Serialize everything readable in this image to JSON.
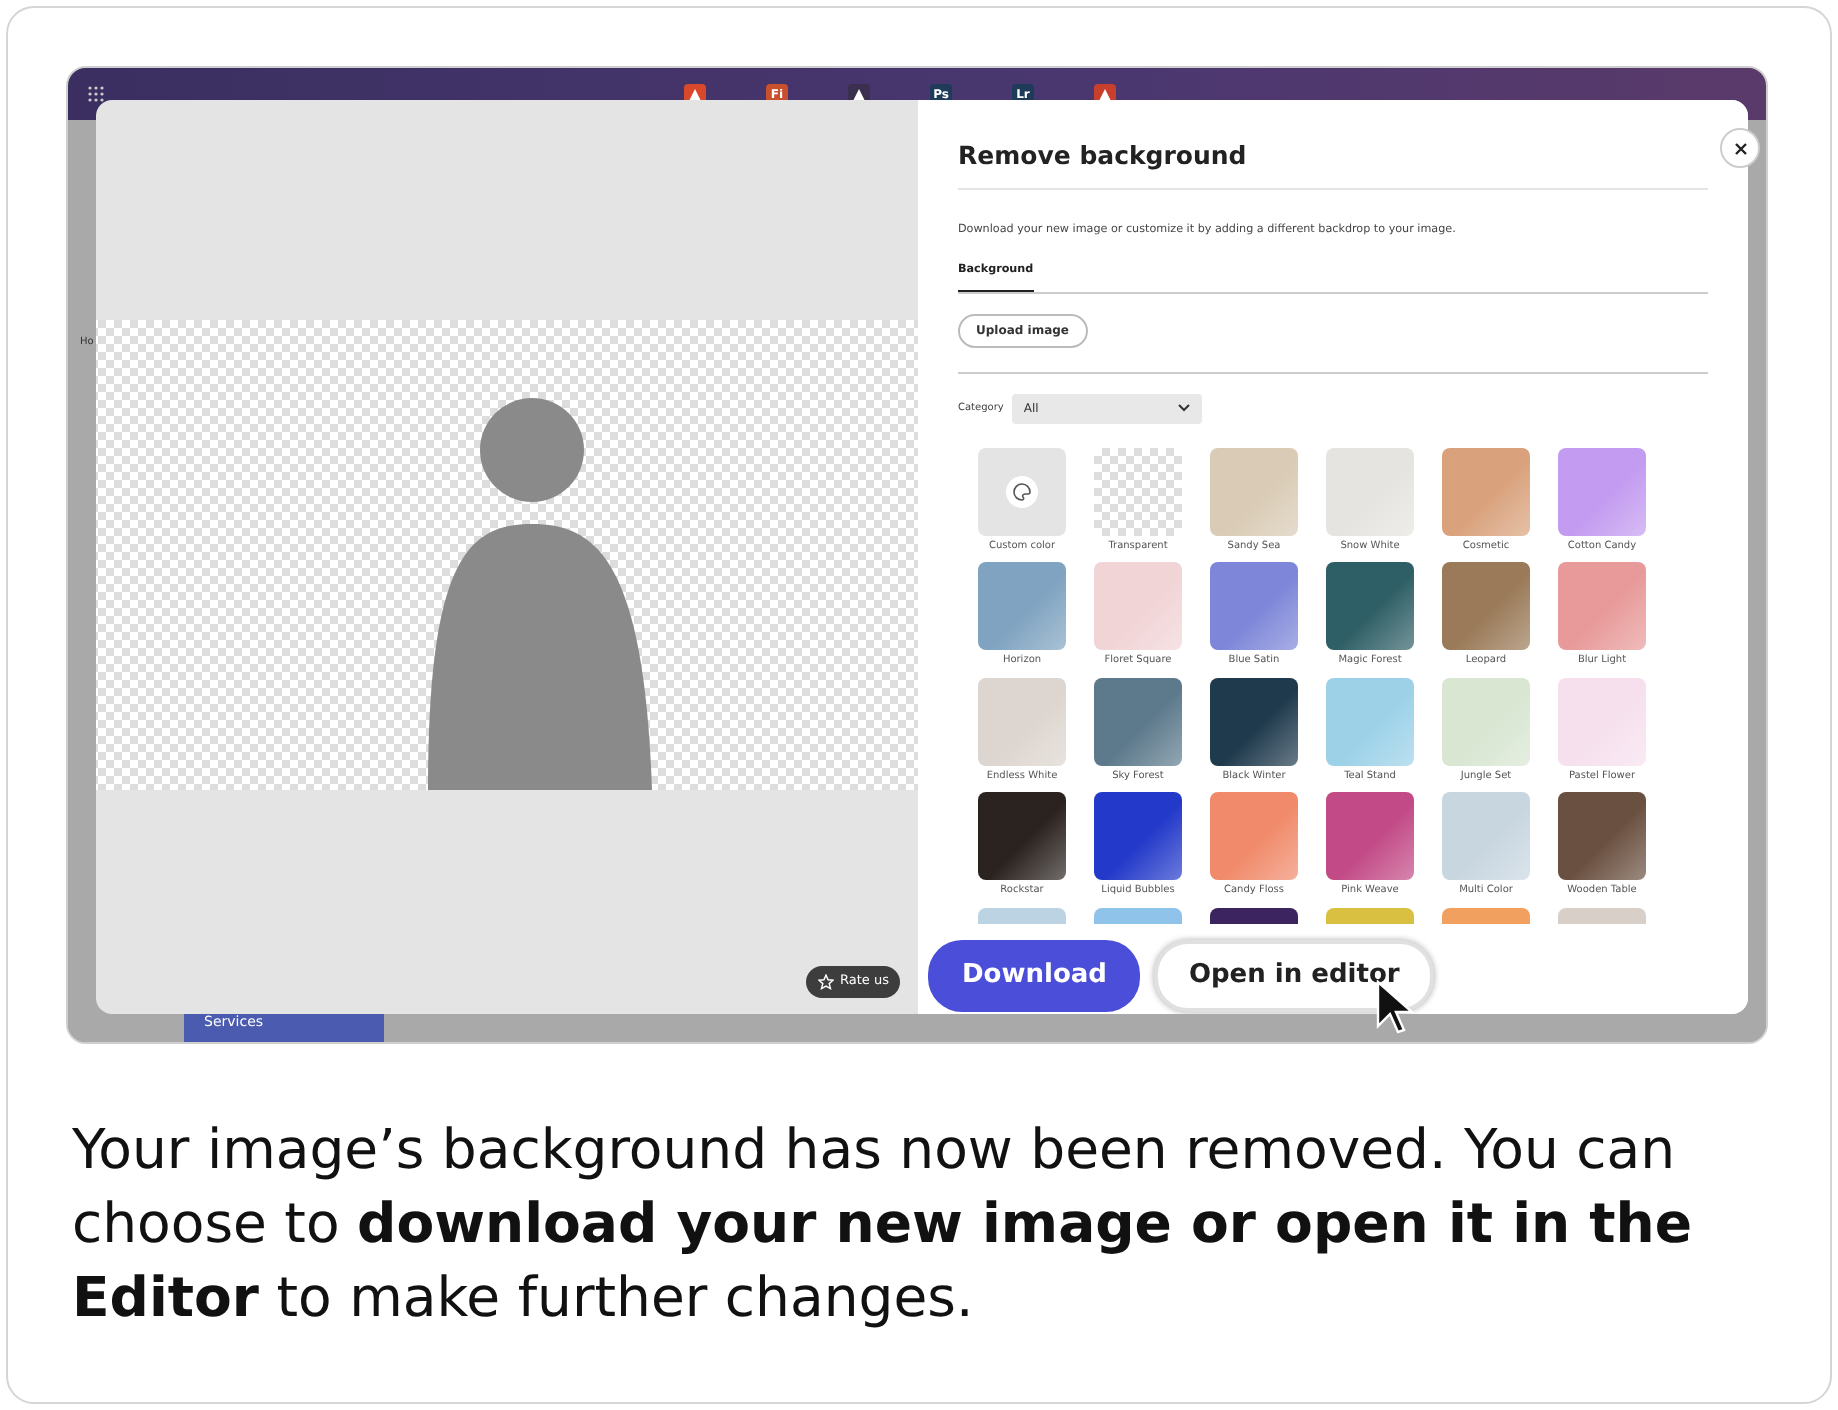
{
  "app_bar": {
    "apps": [
      {
        "kind": "logo",
        "color": "#d9482b"
      },
      {
        "kind": "text",
        "label": "Fi",
        "color": "#c8502c"
      },
      {
        "kind": "logo",
        "color": "#3a2f4f"
      },
      {
        "kind": "text",
        "label": "Ps",
        "color": "#1f3b5a"
      },
      {
        "kind": "text",
        "label": "Lr",
        "color": "#1f3b5a"
      },
      {
        "kind": "logo",
        "color": "#c8402c"
      }
    ]
  },
  "background_app": {
    "nav_label": "Ho",
    "banner": "Services"
  },
  "image_area": {
    "rate_button": "Rate us"
  },
  "panel": {
    "title": "Remove background",
    "description": "Download your new image or customize it by adding a different backdrop to your image.",
    "tabs": [
      {
        "label": "Background",
        "selected": true
      }
    ],
    "upload_button": "Upload image",
    "category": {
      "label": "Category",
      "value": "All"
    },
    "swatches": [
      {
        "label": "Custom color",
        "kind": "custom",
        "color": "#e4e4e4"
      },
      {
        "label": "Transparent",
        "kind": "transparent",
        "color": "#ffffff"
      },
      {
        "label": "Sandy Sea",
        "kind": "image",
        "color": "#d9cbb5"
      },
      {
        "label": "Snow White",
        "kind": "image",
        "color": "#e6e4e0"
      },
      {
        "label": "Cosmetic",
        "kind": "image",
        "color": "#d9a27c"
      },
      {
        "label": "Cotton Candy",
        "kind": "image",
        "color": "#c39bf0"
      },
      {
        "label": "Horizon",
        "kind": "image",
        "color": "#7fa3c0"
      },
      {
        "label": "Floret Square",
        "kind": "image",
        "color": "#f1d4d6"
      },
      {
        "label": "Blue Satin",
        "kind": "image",
        "color": "#7d86d8"
      },
      {
        "label": "Magic Forest",
        "kind": "image",
        "color": "#2f5f66"
      },
      {
        "label": "Leopard",
        "kind": "image",
        "color": "#9a7a58"
      },
      {
        "label": "Blur Light",
        "kind": "image",
        "color": "#e89a9a"
      },
      {
        "label": "Endless White",
        "kind": "image",
        "color": "#ddd5cf"
      },
      {
        "label": "Sky Forest",
        "kind": "image",
        "color": "#5d7a8c"
      },
      {
        "label": "Black Winter",
        "kind": "image",
        "color": "#1f3a4d"
      },
      {
        "label": "Teal Stand",
        "kind": "image",
        "color": "#9cd1e8"
      },
      {
        "label": "Jungle Set",
        "kind": "image",
        "color": "#d8e6d2"
      },
      {
        "label": "Pastel Flower",
        "kind": "image",
        "color": "#f6e0ee"
      },
      {
        "label": "Rockstar",
        "kind": "image",
        "color": "#2b2320"
      },
      {
        "label": "Liquid Bubbles",
        "kind": "image",
        "color": "#2339c9"
      },
      {
        "label": "Candy Floss",
        "kind": "image",
        "color": "#f08a6a"
      },
      {
        "label": "Pink Weave",
        "kind": "image",
        "color": "#c24a86"
      },
      {
        "label": "Multi Color",
        "kind": "image",
        "color": "#c8d6e0"
      },
      {
        "label": "Wooden Table",
        "kind": "image",
        "color": "#6a5040"
      }
    ],
    "more_swatches": [
      {
        "color": "#bcd3e3"
      },
      {
        "color": "#8fc3ea"
      },
      {
        "color": "#3b2460"
      },
      {
        "color": "#d9c040"
      },
      {
        "color": "#f2a060"
      },
      {
        "color": "#d8d0c8"
      }
    ],
    "download_button": "Download",
    "editor_button": "Open in editor"
  },
  "caption": "Your image’s background has now been removed. You can choose to **download your new image or open it in the Editor** to make further changes."
}
